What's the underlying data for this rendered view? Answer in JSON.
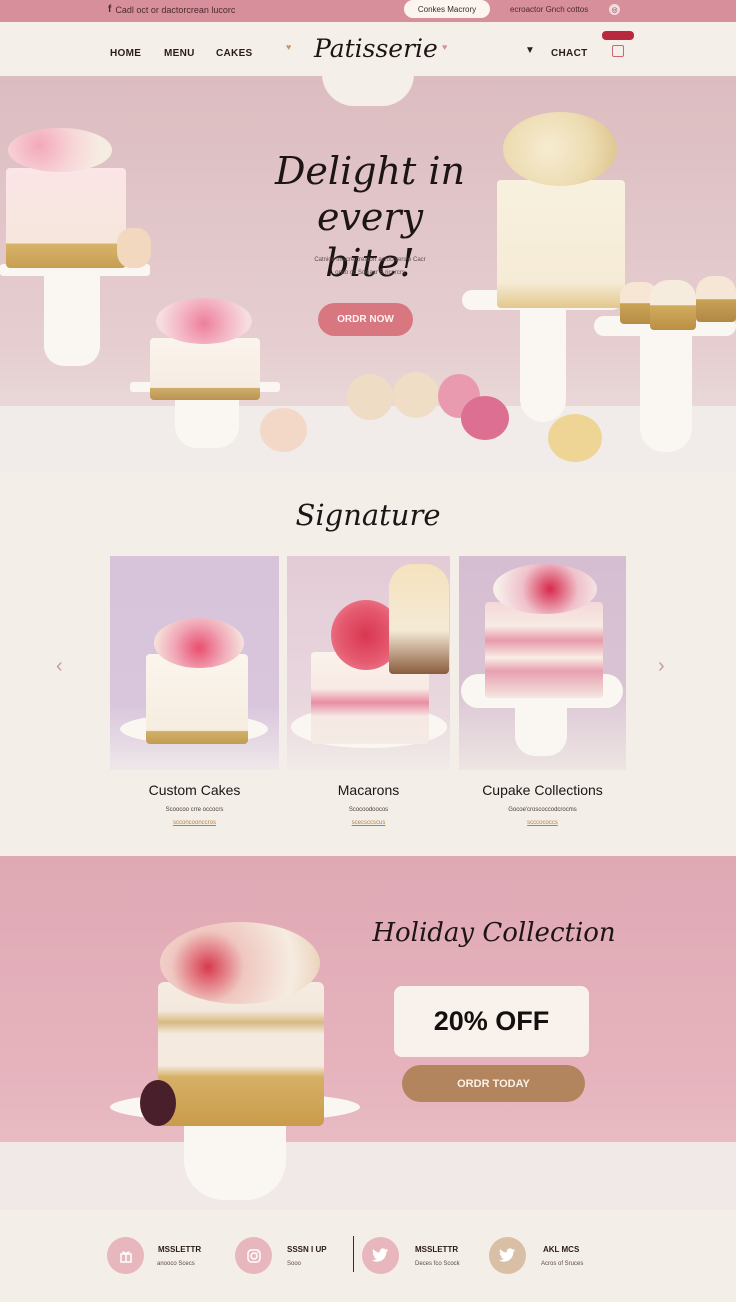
{
  "topbar": {
    "left_text": "Cadl oct or dactorcrean lucorc",
    "pill_label": "Conkes Macrory",
    "right_text": "ecroactor Gnch cottos"
  },
  "nav": {
    "home": "HOME",
    "menu": "MENU",
    "cakes": "CAKES",
    "logo": "Patisserie",
    "contact": "CHACT"
  },
  "hero": {
    "title_line1": "Delight in",
    "title_line2": "every bite!",
    "sub_line1": "Catnice lmacre creatorr acroccrers e Cacr",
    "sub_line2": "onco co Sociacr S ricorcrs",
    "cta": "ORDR NOW"
  },
  "signature": {
    "title": "Signature",
    "cards": [
      {
        "title": "Custom Cakes",
        "desc": "Scoocoo crre occocrs",
        "link": "scconcoonccros"
      },
      {
        "title": "Macarons",
        "desc": "Scocoodoocos",
        "link": "scecsccscus"
      },
      {
        "title": "Cupake Collections",
        "desc": "Gocoe'croscoccodcrocms",
        "link": "scccococcs"
      }
    ]
  },
  "holiday": {
    "title": "Holiday Collection",
    "offer": "20% OFF",
    "cta": "ORDR TODAY"
  },
  "footer": {
    "items": [
      {
        "title": "MSSLETTR",
        "sub": "anooco Scecs",
        "icon": "gift-icon"
      },
      {
        "title": "SSSN I UP",
        "sub": "Sooo",
        "icon": "instagram-icon"
      },
      {
        "title": "MSSLETTR",
        "sub": "Deces fco Scock",
        "icon": "twitter-icon"
      },
      {
        "title": "AKL MCS",
        "sub": "Acros of Sruces",
        "icon": "twitter-icon"
      }
    ]
  },
  "colors": {
    "topbar": "#d88f9c",
    "hero_pink": "#dcbcc0",
    "order_button": "#d97781",
    "holiday_pink": "#e6b3bd",
    "today_button": "#b3855f",
    "cream": "#f4eee9"
  }
}
